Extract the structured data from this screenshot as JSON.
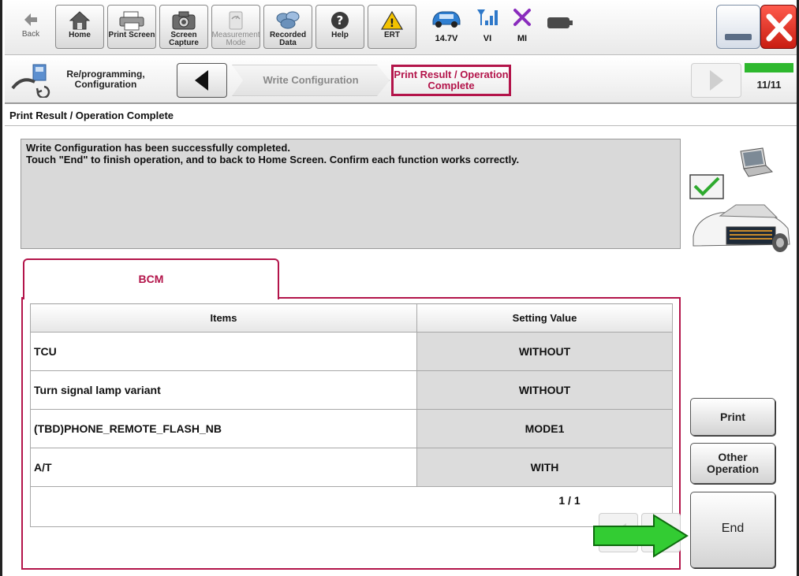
{
  "toolbar": {
    "back": "Back",
    "home": "Home",
    "print_screen": "Print Screen",
    "screen_capture": "Screen Capture",
    "measurement_mode": "Measurement Mode",
    "recorded_data": "Recorded Data",
    "help": "Help",
    "ert": "ERT",
    "battery_voltage": "14.7V",
    "vi_label": "VI",
    "mi_label": "MI"
  },
  "breadcrumb": {
    "title": "Re/programming, Configuration",
    "step1": "Write Configuration",
    "step2": "Print Result / Operation Complete",
    "progress": "11/11"
  },
  "section_title": "Print Result / Operation Complete",
  "message": {
    "line1": "Write Configuration has been successfully completed.",
    "line2": "Touch \"End\" to finish operation, and to back to Home Screen. Confirm each function works correctly."
  },
  "tab": {
    "label": "BCM"
  },
  "table": {
    "headers": [
      "Items",
      "Setting Value"
    ],
    "rows": [
      {
        "item": "TCU",
        "value": "WITHOUT"
      },
      {
        "item": "Turn signal lamp variant",
        "value": "WITHOUT"
      },
      {
        "item": "(TBD)PHONE_REMOTE_FLASH_NB",
        "value": "MODE1"
      },
      {
        "item": "A/T",
        "value": "WITH"
      }
    ]
  },
  "pagination": {
    "counter": "1 / 1"
  },
  "buttons": {
    "print": "Print",
    "other_operation": "Other Operation",
    "end": "End"
  },
  "colors": {
    "accent": "#b3144a",
    "progress": "#2eb82e",
    "arrow": "#33cc33",
    "close": "#d9261c"
  }
}
